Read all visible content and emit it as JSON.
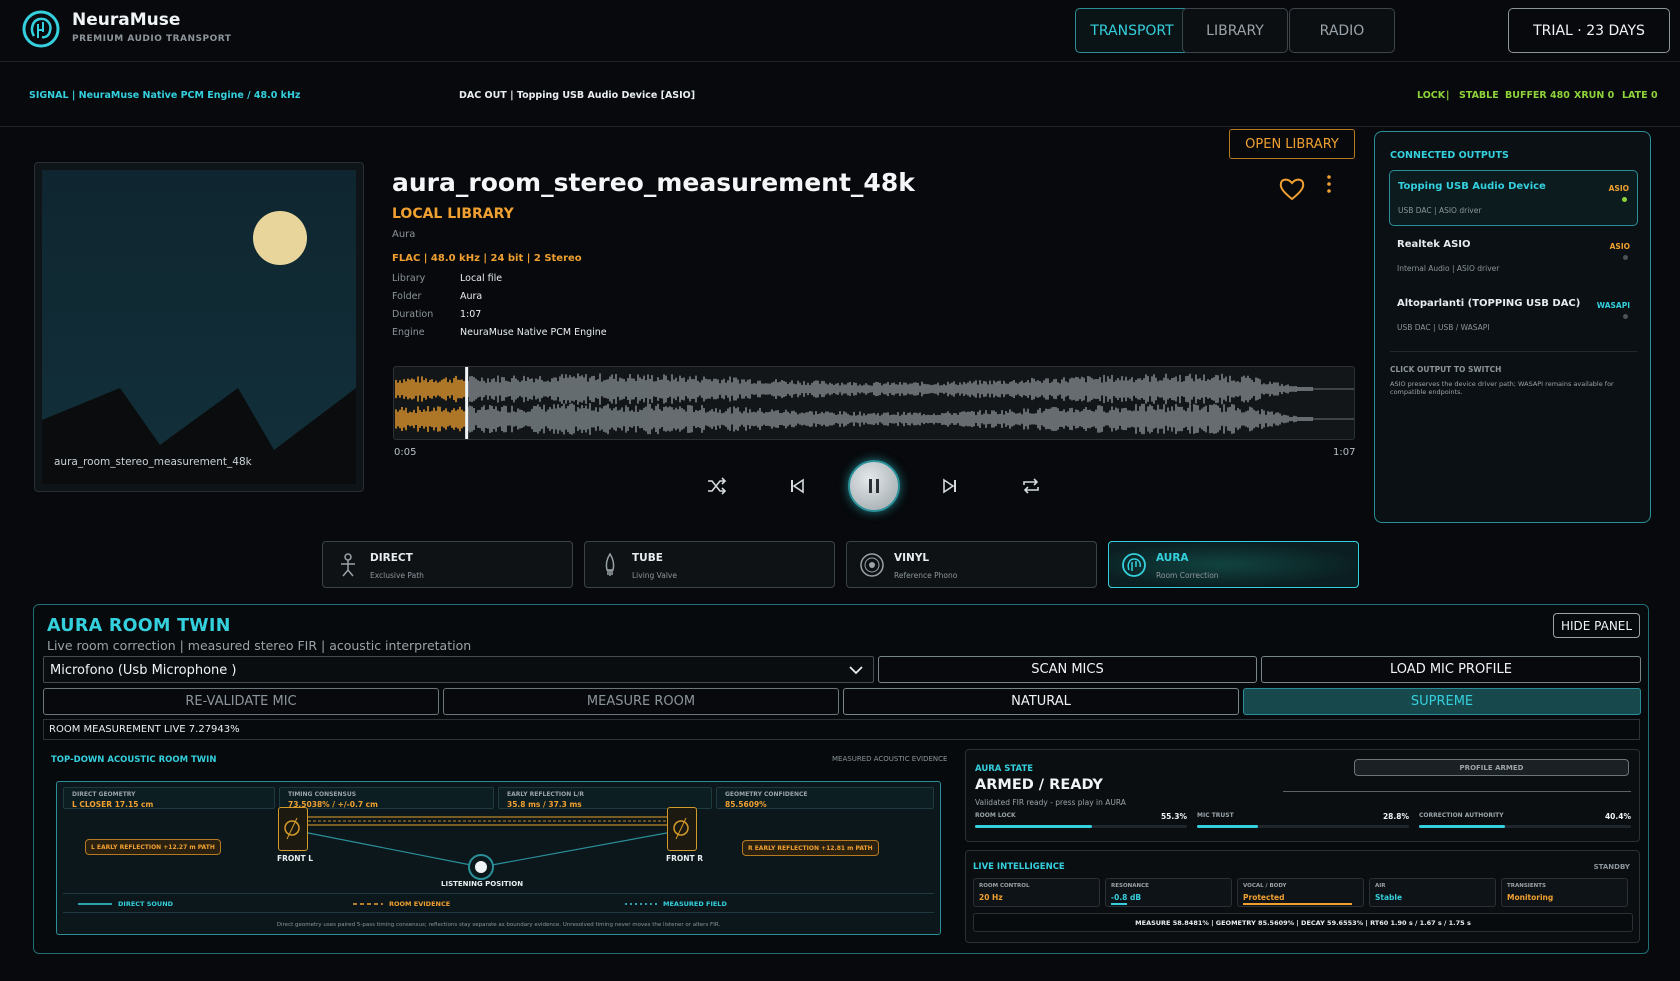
{
  "header": {
    "brand": "NeuraMuse",
    "tagline": "PREMIUM AUDIO TRANSPORT",
    "nav": [
      "TRANSPORT",
      "LIBRARY",
      "RADIO"
    ],
    "trial": "TRIAL · 23 DAYS"
  },
  "signal": {
    "left": "SIGNAL  |  NeuraMuse Native PCM Engine / 48.0 kHz",
    "dac": "DAC OUT  |  Topping USB Audio Device  [ASIO]",
    "status": [
      "LOCK",
      "|",
      "STABLE",
      "BUFFER 480",
      "XRUN 0",
      "LATE 0"
    ]
  },
  "track": {
    "art_caption": "aura_room_stereo_measurement_48k",
    "title": "aura_room_stereo_measurement_48k",
    "source": "LOCAL LIBRARY",
    "artist": "Aura",
    "format": "FLAC  |  48.0 kHz  |  24 bit  |  2 Stereo",
    "meta": [
      {
        "k": "Library",
        "v": "Local file"
      },
      {
        "k": "Folder",
        "v": "Aura"
      },
      {
        "k": "Duration",
        "v": "1:07"
      },
      {
        "k": "Engine",
        "v": "NeuraMuse Native PCM Engine"
      }
    ],
    "elapsed": "0:05",
    "total": "1:07",
    "progress": 0.075,
    "open_library": "OPEN LIBRARY"
  },
  "outputs": {
    "heading": "CONNECTED OUTPUTS",
    "items": [
      {
        "name": "Topping USB Audio Device",
        "sub": "USB DAC  |  ASIO driver",
        "tag": "ASIO",
        "selected": true
      },
      {
        "name": "Realtek ASIO",
        "sub": "Internal Audio  |  ASIO driver",
        "tag": "ASIO",
        "selected": false
      },
      {
        "name": "Altoparlanti (TOPPING USB DAC)",
        "sub": "USB DAC  |  USB / WASAPI",
        "tag": "WASAPI",
        "selected": false
      }
    ],
    "click_hint": "CLICK OUTPUT TO SWITCH",
    "note": "ASIO preserves the device driver path; WASAPI remains available for compatible endpoints."
  },
  "modes": [
    {
      "label": "DIRECT",
      "sub": "Exclusive Path",
      "icon": "direct-icon"
    },
    {
      "label": "TUBE",
      "sub": "Living Valve",
      "icon": "tube-icon"
    },
    {
      "label": "VINYL",
      "sub": "Reference Phono",
      "icon": "vinyl-icon"
    },
    {
      "label": "AURA",
      "sub": "Room Correction",
      "icon": "aura-icon"
    }
  ],
  "aura": {
    "title": "AURA ROOM TWIN",
    "subtitle": "Live room correction | measured stereo FIR | acoustic interpretation",
    "hide": "HIDE PANEL",
    "mic": "Microfono (Usb  Microphone        )",
    "scan": "SCAN MICS",
    "load": "LOAD MIC PROFILE",
    "revalidate": "RE-VALIDATE MIC",
    "measure": "MEASURE ROOM",
    "natural": "NATURAL",
    "supreme": "SUPREME",
    "live": "ROOM MEASUREMENT LIVE  7.27943%"
  },
  "room": {
    "heading": "TOP-DOWN ACOUSTIC ROOM TWIN",
    "evidence": "MEASURED ACOUSTIC EVIDENCE",
    "cells": [
      {
        "label": "DIRECT GEOMETRY",
        "value": "L CLOSER  17.15 cm"
      },
      {
        "label": "TIMING CONSENSUS",
        "value": "73.5038% / +/-0.7 cm"
      },
      {
        "label": "EARLY REFLECTION L/R",
        "value": "35.8 ms / 37.3 ms"
      },
      {
        "label": "GEOMETRY CONFIDENCE",
        "value": "85.5609%"
      }
    ],
    "refl_left": "L EARLY REFLECTION  +12.27 m PATH",
    "refl_right": "R EARLY REFLECTION  +12.81 m PATH",
    "front_l": "FRONT L",
    "front_r": "FRONT R",
    "listening": "LISTENING POSITION",
    "legend": [
      "DIRECT SOUND",
      "ROOM EVIDENCE",
      "MEASURED FIELD"
    ],
    "foot": "Direct geometry uses paired 5-pass timing consensus; reflections stay separate as boundary evidence. Unresolved timing never moves the listener or alters FIR."
  },
  "state": {
    "heading": "AURA STATE",
    "value": "ARMED / READY",
    "sub": "Validated FIR ready - press play in AURA",
    "badge": "PROFILE ARMED",
    "meters": [
      {
        "label": "ROOM LOCK",
        "value": "55.3%",
        "fill": 0.553
      },
      {
        "label": "MIC TRUST",
        "value": "28.8%",
        "fill": 0.288
      },
      {
        "label": "CORRECTION AUTHORITY",
        "value": "40.4%",
        "fill": 0.404
      }
    ]
  },
  "intel": {
    "heading": "LIVE INTELLIGENCE",
    "status": "STANDBY",
    "cells": [
      {
        "label": "ROOM CONTROL",
        "value": "20 Hz",
        "color": "#f0a030"
      },
      {
        "label": "RESONANCE",
        "value": "-0.8 dB",
        "color": "#35d0de"
      },
      {
        "label": "VOCAL / BODY",
        "value": "Protected",
        "color": "#f0a030"
      },
      {
        "label": "AIR",
        "value": "Stable",
        "color": "#35d0de"
      },
      {
        "label": "TRANSIENTS",
        "value": "Monitoring",
        "color": "#f0a030"
      }
    ],
    "summary": "MEASURE 58.8481%  |  GEOMETRY 85.5609%  |  DECAY 59.6553%  |  RT60  1.90 s  /  1.67 s  /  1.75 s"
  }
}
